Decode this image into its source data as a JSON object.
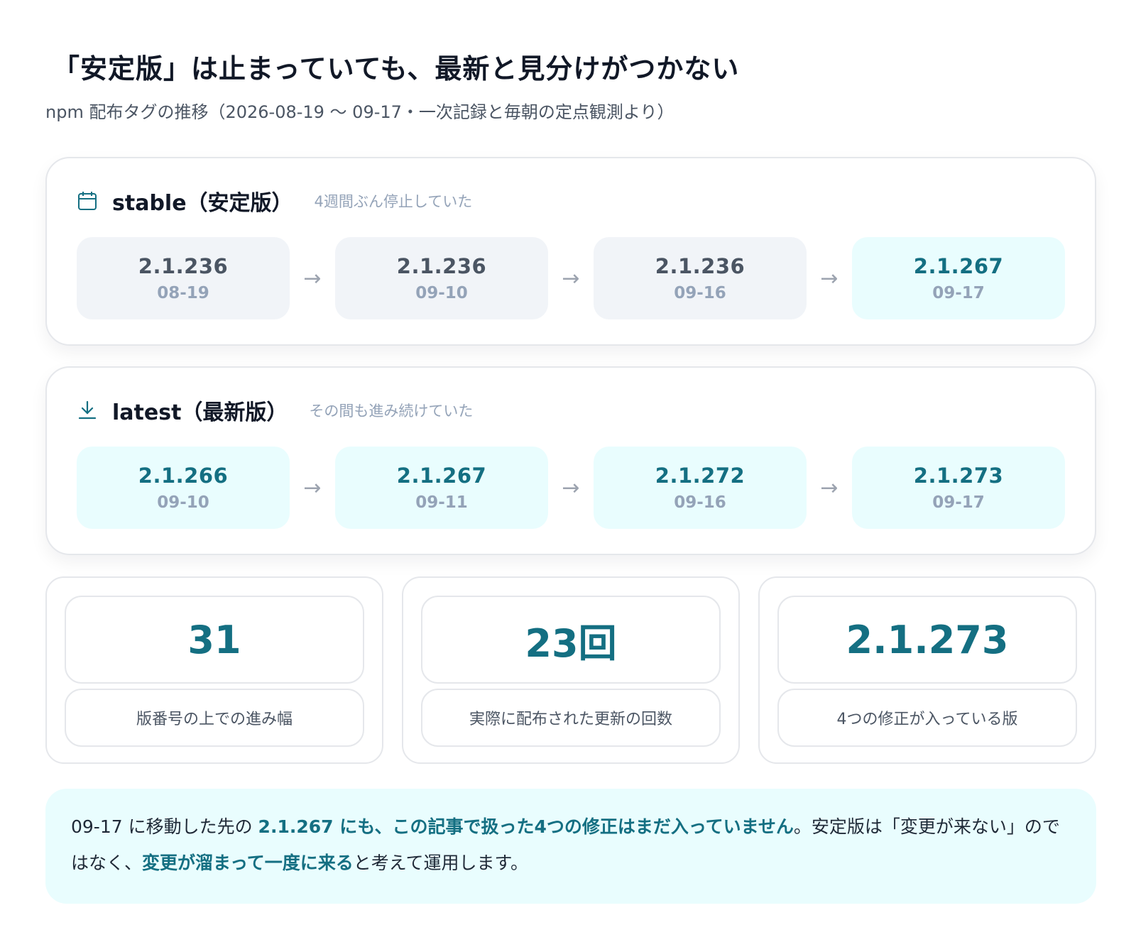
{
  "title": "「安定版」は止まっていても、最新と見分けがつかない",
  "subtitle": "npm 配布タグの推移（2026-08-19 〜 09-17・一次記録と毎朝の定点観測より）",
  "colors": {
    "accent": "#146f82",
    "chip_active": "#e9fdfe",
    "chip_idle": "#f1f4f8"
  },
  "arrow": "→",
  "stable": {
    "icon": "calendar-icon",
    "name": "stable（安定版）",
    "note": "4週間ぶん停止していた",
    "steps": [
      {
        "version": "2.1.236",
        "date": "08-19"
      },
      {
        "version": "2.1.236",
        "date": "09-10"
      },
      {
        "version": "2.1.236",
        "date": "09-16"
      },
      {
        "version": "2.1.267",
        "date": "09-17"
      }
    ]
  },
  "latest": {
    "icon": "download-icon",
    "name": "latest（最新版）",
    "note": "その間も進み続けていた",
    "steps": [
      {
        "version": "2.1.266",
        "date": "09-10"
      },
      {
        "version": "2.1.267",
        "date": "09-11"
      },
      {
        "version": "2.1.272",
        "date": "09-16"
      },
      {
        "version": "2.1.273",
        "date": "09-17"
      }
    ]
  },
  "stats": [
    {
      "value": "31",
      "label": "版番号の上での進み幅"
    },
    {
      "value": "23回",
      "label": "実際に配布された更新の回数"
    },
    {
      "value": "2.1.273",
      "label": "4つの修正が入っている版"
    }
  ],
  "callout": {
    "part1": "09-17 に移動した先の ",
    "em1": "2.1.267 にも、この記事で扱った4つの修正はまだ入っていません",
    "part2": "。安定版は「変更が来ない」のではなく、",
    "em2": "変更が溜まって一度に来る",
    "part3": "と考えて運用します。"
  }
}
